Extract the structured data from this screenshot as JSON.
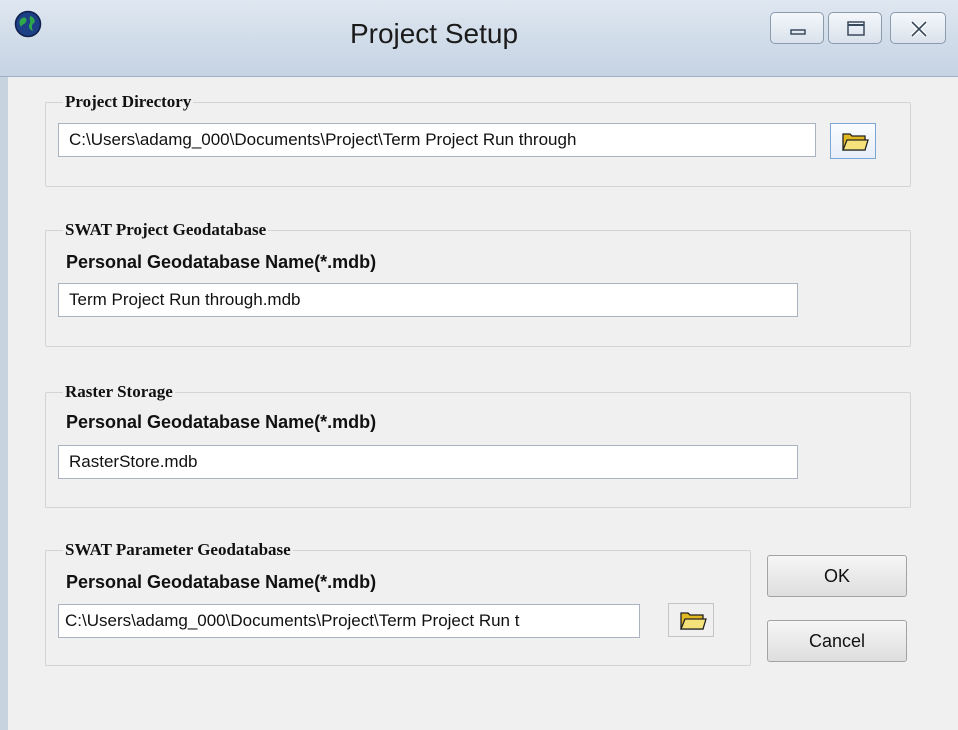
{
  "window": {
    "title": "Project Setup",
    "icons": {
      "app": "globe-icon",
      "minimize": "minimize-icon",
      "maximize": "maximize-icon",
      "close": "close-icon"
    }
  },
  "project_directory": {
    "title": "Project Directory",
    "path": "C:\\Users\\adamg_000\\Documents\\Project\\Term Project Run through",
    "browse_icon": "folder-icon"
  },
  "swat_project_gdb": {
    "title": "SWAT Project Geodatabase",
    "label": "Personal Geodatabase Name(*.mdb)",
    "value": "Term Project Run through.mdb"
  },
  "raster_storage": {
    "title": "Raster Storage",
    "label": "Personal Geodatabase Name(*.mdb)",
    "value": "RasterStore.mdb"
  },
  "swat_parameter_gdb": {
    "title": "SWAT Parameter Geodatabase",
    "label": "Personal Geodatabase Name(*.mdb)",
    "value": "C:\\Users\\adamg_000\\Documents\\Project\\Term Project Run t",
    "browse_icon": "folder-icon"
  },
  "buttons": {
    "ok": "OK",
    "cancel": "Cancel"
  },
  "colors": {
    "titlebar": "#cfdbe8",
    "background": "#f0f0f0",
    "folder": "#f3d64e"
  }
}
